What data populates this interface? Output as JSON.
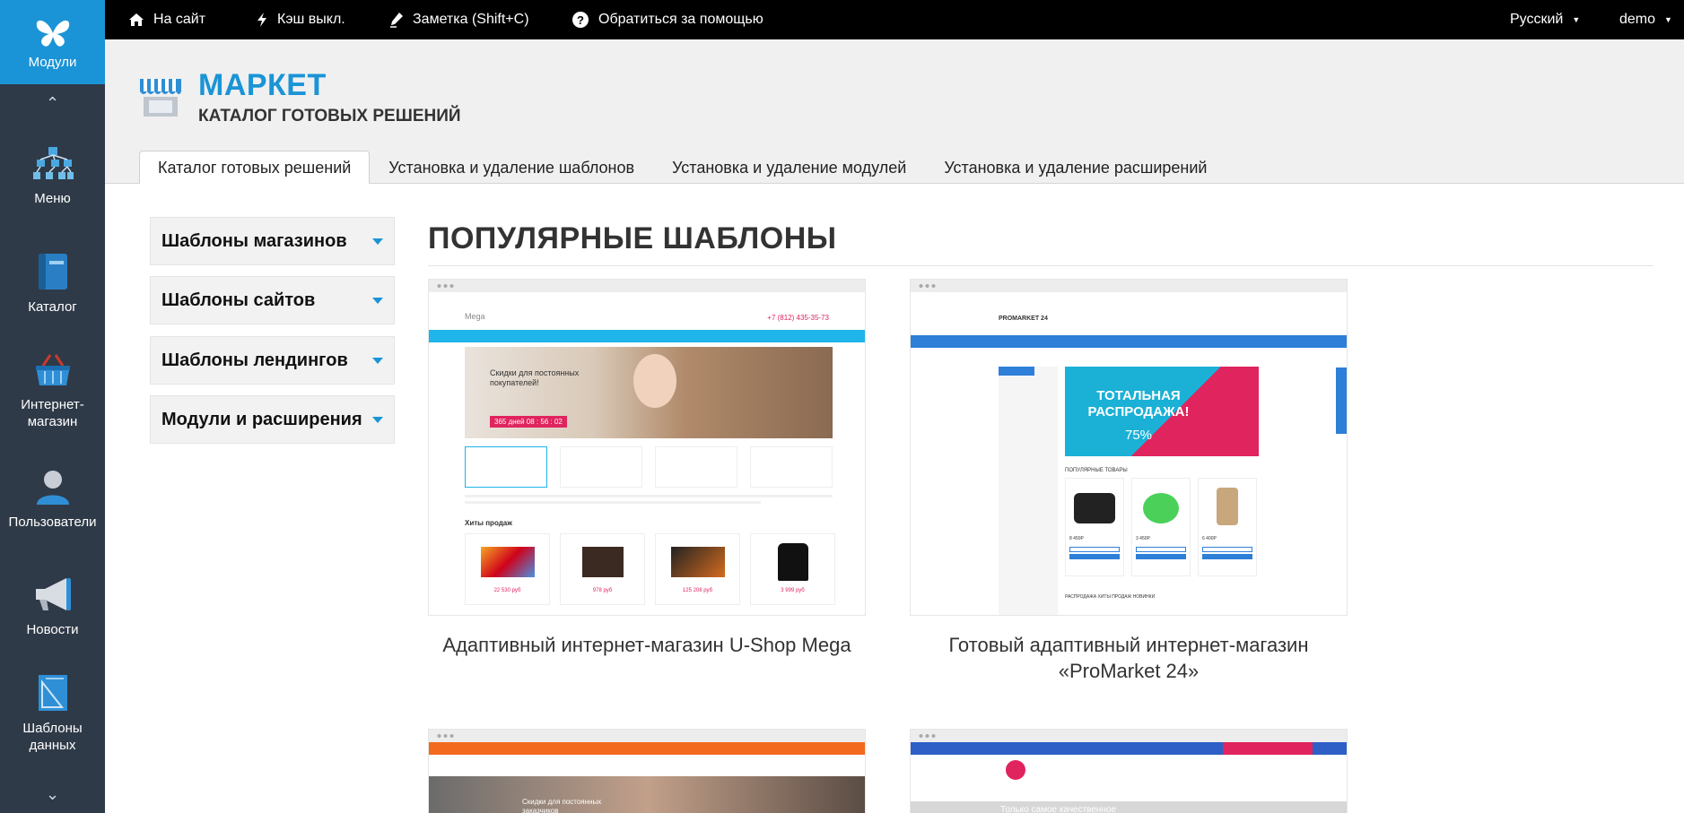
{
  "sidebar": {
    "modules_label": "Модули",
    "items": [
      {
        "label": "Меню",
        "icon": "menu-tree-icon"
      },
      {
        "label": "Каталог",
        "icon": "book-icon"
      },
      {
        "label": "Интернет-магазин",
        "icon": "basket-icon"
      },
      {
        "label": "Пользователи",
        "icon": "user-icon"
      },
      {
        "label": "Новости",
        "icon": "megaphone-icon"
      },
      {
        "label": "Шаблоны данных",
        "icon": "template-icon"
      }
    ]
  },
  "topbar": {
    "site": "На сайт",
    "cache": "Кэш выкл.",
    "note": "Заметка (Shift+C)",
    "help": "Обратиться за помощью",
    "language": "Русский",
    "user": "demo"
  },
  "header": {
    "title": "МАРКЕТ",
    "subtitle": "КАТАЛОГ ГОТОВЫХ РЕШЕНИЙ"
  },
  "tabs": [
    {
      "label": "Каталог готовых решений",
      "active": true
    },
    {
      "label": "Установка и удаление шаблонов",
      "active": false
    },
    {
      "label": "Установка и удаление модулей",
      "active": false
    },
    {
      "label": "Установка и удаление расширений",
      "active": false
    }
  ],
  "accordion": [
    "Шаблоны магазинов",
    "Шаблоны сайтов",
    "Шаблоны лендингов",
    "Модули и расширения"
  ],
  "section_title": "ПОПУЛЯРНЫЕ ШАБЛОНЫ",
  "cards": [
    {
      "caption": "Адаптивный интернет-магазин U-Shop Mega",
      "preview": {
        "brand": "Mega",
        "phone": "+7 (812) 435-35-73",
        "banner": "Скидки для постоянных покупателей!",
        "timer": "365 дней 08 : 56 : 02",
        "block": "Хиты продаж",
        "prices": [
          "22 530 руб",
          "978 руб",
          "125 208 руб",
          "3 999 руб"
        ]
      }
    },
    {
      "caption": "Готовый адаптивный интернет-магазин «ProMarket 24»",
      "preview": {
        "brand": "PROMARKET 24",
        "banner": "ТОТАЛЬНАЯ РАСПРОДАЖА!",
        "percent": "75%",
        "block": "ПОПУЛЯРНЫЕ ТОВАРЫ",
        "prices": [
          "8 450Р",
          "3 450Р",
          "6 400Р"
        ],
        "tabs": "РАСПРОДАЖА   ХИТЫ ПРОДАЖ   НОВИНКИ"
      }
    },
    {
      "caption": "",
      "preview": {
        "banner": "Скидки для постоянных заказчиков"
      }
    },
    {
      "caption": "",
      "preview": {
        "banner": "Только самое качественное"
      }
    }
  ],
  "colors": {
    "accent": "#1a94d6",
    "sidebar": "#2f3a48",
    "topbar": "#000000"
  }
}
